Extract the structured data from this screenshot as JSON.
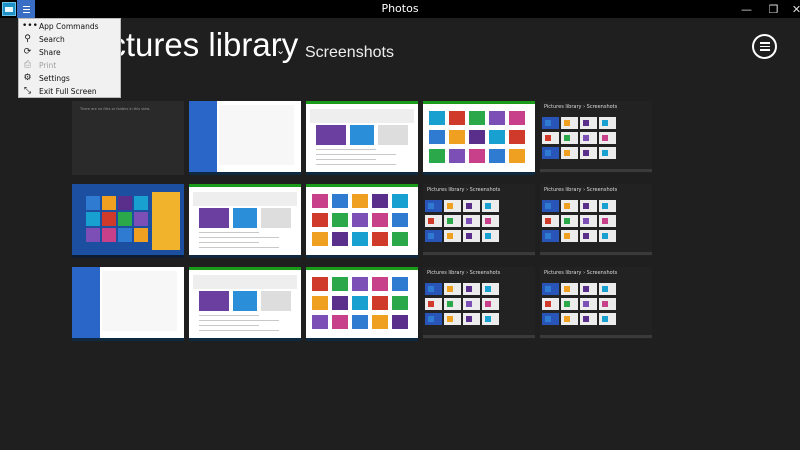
{
  "window": {
    "title": "Photos",
    "controls": {
      "minimize": "—",
      "restore": "❐",
      "close": "✕"
    }
  },
  "header": {
    "title": "Pictures library",
    "chevron": "⌄",
    "subtitle": "Screenshots"
  },
  "menu": {
    "items": [
      {
        "label": "App Commands",
        "icon": "more-icon",
        "glyph": "•••",
        "disabled": false
      },
      {
        "label": "Search",
        "icon": "search-icon",
        "glyph": "⚲",
        "disabled": false
      },
      {
        "label": "Share",
        "icon": "share-icon",
        "glyph": "⟳",
        "disabled": false
      },
      {
        "label": "Print",
        "icon": "print-icon",
        "glyph": "⎙",
        "disabled": true
      },
      {
        "label": "Settings",
        "icon": "gear-icon",
        "glyph": "⚙",
        "disabled": false
      },
      {
        "label": "Exit Full Screen",
        "icon": "exit-fullscreen-icon",
        "glyph": "⤡",
        "disabled": false
      }
    ]
  },
  "thumbnails": [
    {
      "caption": "",
      "empty_text": "There are no files or folders in this view."
    },
    {
      "caption": ""
    },
    {
      "caption": ""
    },
    {
      "caption": ""
    },
    {
      "caption": "Pictures library › Screenshots"
    },
    {
      "caption": ""
    },
    {
      "caption": ""
    },
    {
      "caption": ""
    },
    {
      "caption": "Pictures library › Screenshots"
    },
    {
      "caption": "Pictures library › Screenshots"
    },
    {
      "caption": ""
    },
    {
      "caption": ""
    },
    {
      "caption": ""
    },
    {
      "caption": "Pictures library › Screenshots"
    },
    {
      "caption": "Pictures library › Screenshots"
    }
  ],
  "colors": {
    "background": "#1f1f1f",
    "titlebar": "#000000",
    "accent": "#3a6ec4",
    "store_green": "#1a9b1a",
    "menu_bg": "#f1f1f1"
  }
}
